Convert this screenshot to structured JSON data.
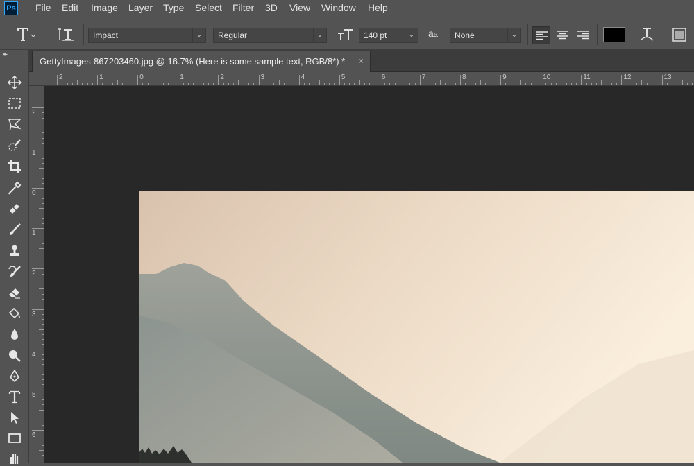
{
  "app": {
    "logo_text": "Ps"
  },
  "menu": [
    "File",
    "Edit",
    "Image",
    "Layer",
    "Type",
    "Select",
    "Filter",
    "3D",
    "View",
    "Window",
    "Help"
  ],
  "options": {
    "font_family": "Impact",
    "font_style": "Regular",
    "font_size": "140 pt",
    "antialias_glyph": "a",
    "antialias_glyph_small": "a",
    "antialias": "None",
    "text_color": "#000000",
    "alignment": "left"
  },
  "document": {
    "tab_title": "GettyImages-867203460.jpg @ 16.7% (Here is some sample text, RGB/8*) *",
    "close_glyph": "×"
  },
  "rulers": {
    "horizontal": [
      "2",
      "1",
      "0",
      "1",
      "2",
      "3",
      "4",
      "5",
      "6",
      "7",
      "8",
      "9",
      "10",
      "11",
      "12",
      "13"
    ],
    "vertical": [
      "2",
      "1",
      "0",
      "1",
      "2",
      "3",
      "4",
      "5",
      "6"
    ]
  },
  "tools": [
    "move-tool",
    "marquee-tool",
    "lasso-tool",
    "quick-selection-tool",
    "crop-tool",
    "eyedropper-tool",
    "healing-brush-tool",
    "brush-tool",
    "clone-stamp-tool",
    "history-brush-tool",
    "eraser-tool",
    "paint-bucket-tool",
    "blur-tool",
    "dodge-tool",
    "pen-tool",
    "type-tool",
    "path-selection-tool",
    "rectangle-tool",
    "hand-tool"
  ],
  "colors": {
    "ui_panel": "#535353",
    "pasteboard": "#282828",
    "brand": "#31a8ff"
  }
}
